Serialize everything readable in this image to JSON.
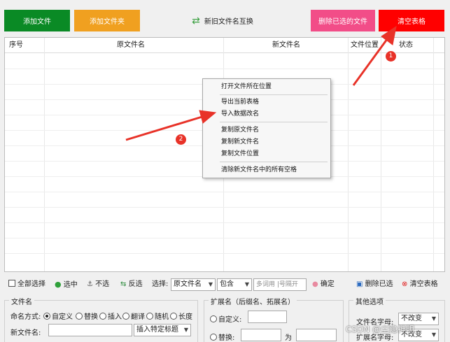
{
  "top": {
    "add_file": "添加文件",
    "add_folder": "添加文件夹",
    "swap_names": "新旧文件名互换",
    "delete_selected": "删除已选的文件",
    "clear_table": "清空表格"
  },
  "table": {
    "columns": [
      "序号",
      "原文件名",
      "新文件名",
      "文件位置",
      "状态"
    ]
  },
  "context_menu": {
    "items": [
      "打开文件所在位置",
      "导出当前表格",
      "导入数据改名",
      "复制原文件名",
      "复制新文件名",
      "复制文件位置",
      "清除新文件名中的所有空格"
    ]
  },
  "annotations": {
    "badge1": "1",
    "badge2": "2"
  },
  "toolbar": {
    "select_all": "全部选择",
    "check_selected": "选中",
    "uncheck": "不选",
    "invert": "反选",
    "select_label": "选择:",
    "field_value": "原文件名",
    "match_value": "包含",
    "keyword_placeholder": "多词用 |号隔开",
    "confirm": "确定",
    "delete_checked": "删除已选",
    "clear_table": "清空表格"
  },
  "filename_group": {
    "title": "文件名",
    "naming_label": "命名方式:",
    "modes": [
      "自定义",
      "替换",
      "插入",
      "翻译",
      "随机",
      "长度"
    ],
    "new_name_label": "新文件名:",
    "insert_title": "插入特定标题"
  },
  "ext_group": {
    "title": "扩展名（后缀名、拓展名）",
    "custom_label": "自定义:",
    "replace_label": "替换:",
    "to_label": "为"
  },
  "other_group": {
    "title": "其他选项",
    "filename_chars_label": "文件名字母:",
    "filename_chars_value": "不改变",
    "ext_chars_label": "扩展名字母:",
    "ext_chars_value": "不改变"
  },
  "watermark": "CSDN @尘隐神明"
}
